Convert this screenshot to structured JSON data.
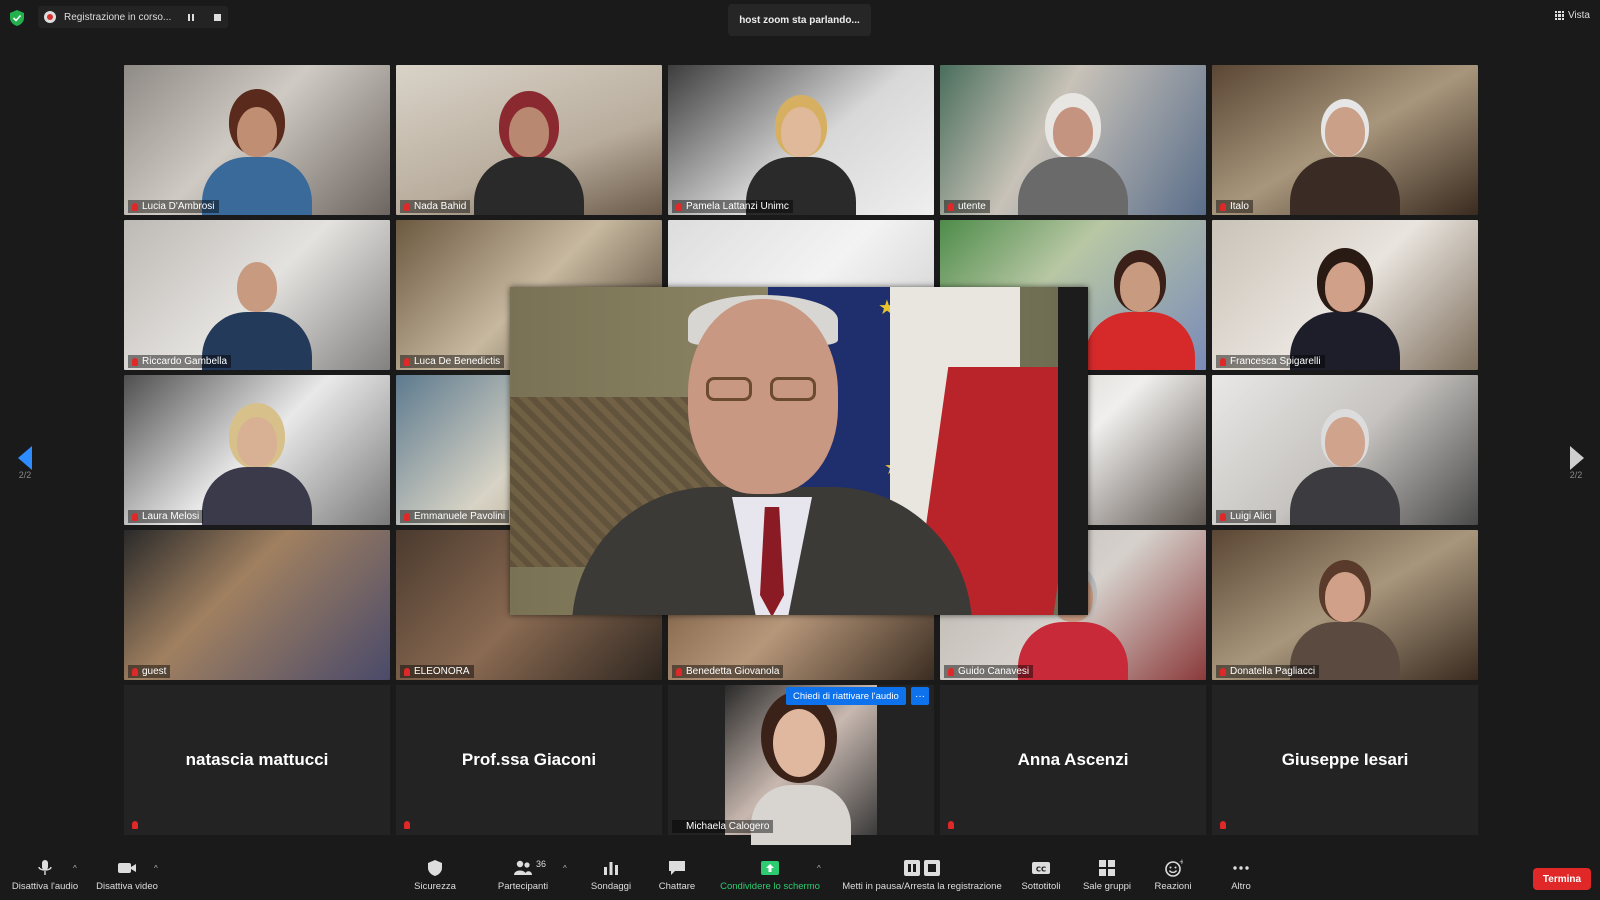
{
  "top": {
    "recording_label": "Registrazione in corso...",
    "speaking_label": "host zoom sta parlando...",
    "view_label": "Vista"
  },
  "pager": {
    "left": "2/2",
    "right": "2/2"
  },
  "participants": [
    "Lucia D'Ambrosi",
    "Nada Bahid",
    "Pamela Lattanzi Unimc",
    "utente",
    "Italo",
    "Riccardo Gambella",
    "Luca De Benedictis",
    "",
    "",
    "Francesca Spigarelli",
    "Laura Melosi",
    "Emmanuele Pavolini",
    "",
    "",
    "Luigi Alici",
    "guest",
    "ELEONORA",
    "Benedetta Giovanola",
    "Guido Canavesi",
    "Donatella Pagliacci"
  ],
  "name_tiles": [
    "natascia mattucci",
    "Prof.ssa Giaconi",
    "Anna Ascenzi",
    "Giuseppe Iesari"
  ],
  "michaela": {
    "name": "Michaela Calogero",
    "chip": "Chiedi di riattivare l'audio",
    "chip_more": "···"
  },
  "toolbar": {
    "mute": "Disattiva l'audio",
    "video": "Disattiva video",
    "security": "Sicurezza",
    "participants": "Partecipanti",
    "participants_count": "36",
    "polls": "Sondaggi",
    "chat": "Chattare",
    "share": "Condividere lo schermo",
    "record": "Metti in pausa/Arresta la registrazione",
    "captions": "Sottotitoli",
    "breakout": "Sale gruppi",
    "reactions": "Reazioni",
    "more": "Altro",
    "end": "Termina"
  },
  "colors": {
    "accent": "#0e72ed",
    "end": "#e02828",
    "share": "#2ecc71"
  }
}
